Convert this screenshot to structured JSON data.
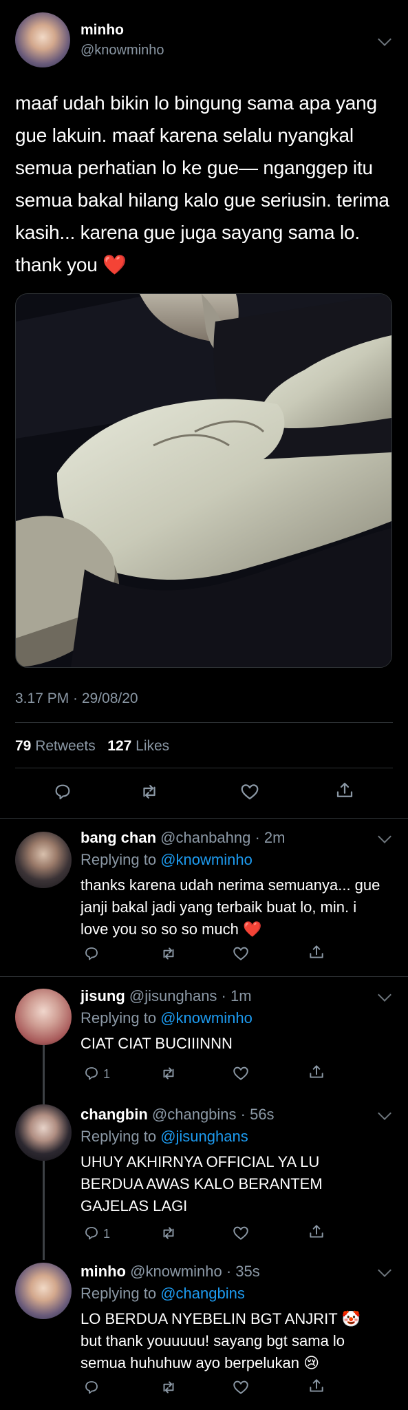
{
  "main_tweet": {
    "name": "minho",
    "handle": "@knowminho",
    "text": "maaf udah bikin lo bingung sama apa yang gue lakuin. maaf karena selalu nyangkal semua perhatian lo ke gue— nganggep itu semua bakal hilang kalo gue seriusin. terima kasih... karena gue juga sayang sama lo. thank you",
    "emoji": "❤️",
    "timestamp": "3.17 PM · 29/08/20",
    "retweets_count": "79",
    "retweets_label": "Retweets",
    "likes_count": "127",
    "likes_label": "Likes"
  },
  "replies": [
    {
      "name": "bang chan",
      "handle": "@chanbahng · 2m",
      "replying_prefix": "Replying to",
      "replying_to": "@knowminho",
      "text": "thanks karena udah nerima semuanya... gue janji bakal jadi yang terbaik buat lo, min. i love you so so so much",
      "emoji": "❤️",
      "reply_count": ""
    },
    {
      "name": "jisung",
      "handle": "@jisunghans · 1m",
      "replying_prefix": "Replying to",
      "replying_to": "@knowminho",
      "text": "CIAT CIAT BUCIIINNN",
      "emoji": "",
      "reply_count": "1"
    },
    {
      "name": "changbin",
      "handle": "@changbins · 56s",
      "replying_prefix": "Replying to",
      "replying_to": "@jisunghans",
      "text": "UHUY AKHIRNYA OFFICIAL YA LU BERDUA AWAS KALO BERANTEM GAJELAS LAGI",
      "emoji": "",
      "reply_count": "1"
    },
    {
      "name": "minho",
      "handle": "@knowminho · 35s",
      "replying_prefix": "Replying to",
      "replying_to": "@changbins",
      "text_line1": "LO BERDUA NYEBELIN BGT ANJRIT",
      "emoji1": "🤡",
      "text_rest": "but thank youuuuu! sayang bgt sama lo semua huhuhuw ayo berpelukan",
      "emoji2": "😢",
      "reply_count": ""
    }
  ],
  "colors": {
    "background": "#000000",
    "secondary_text": "#8b98a5",
    "mention": "#1d9bf0",
    "heart": "#f0263a",
    "divider": "#2f3336"
  },
  "icons": [
    "reply-icon",
    "retweet-icon",
    "like-icon",
    "share-icon",
    "chevron-down-icon",
    "heart-emoji",
    "clown-emoji",
    "crying-emoji"
  ]
}
